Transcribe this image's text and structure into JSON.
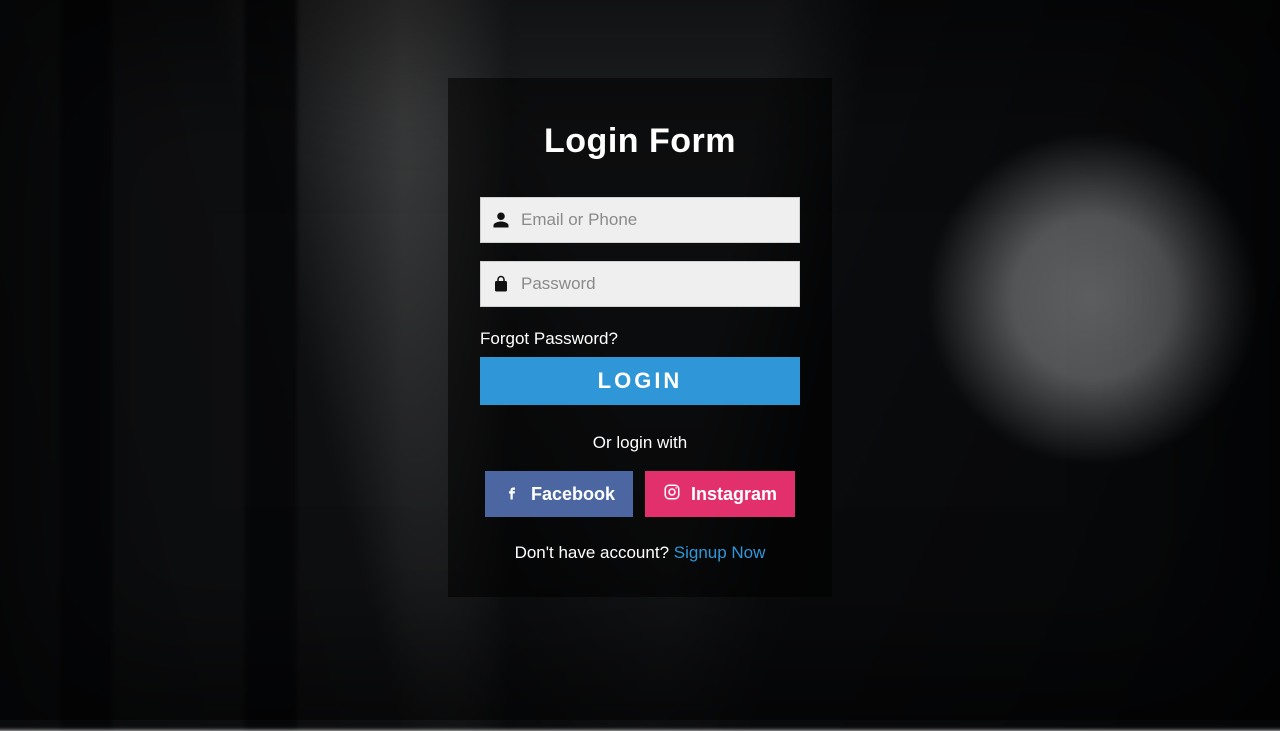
{
  "title": "Login Form",
  "fields": {
    "email_placeholder": "Email or Phone",
    "password_placeholder": "Password"
  },
  "links": {
    "forgot": "Forgot Password?",
    "signup_prompt": "Don't have account? ",
    "signup_action": "Signup Now"
  },
  "buttons": {
    "login": "LOGIN",
    "facebook": "Facebook",
    "instagram": "Instagram"
  },
  "divider": "Or login with",
  "icons": {
    "user": "user-icon",
    "lock": "lock-icon",
    "facebook": "facebook-icon",
    "instagram": "instagram-icon"
  },
  "colors": {
    "primary": "#2f97d8",
    "facebook": "#4b66a0",
    "instagram": "#e1306c"
  }
}
